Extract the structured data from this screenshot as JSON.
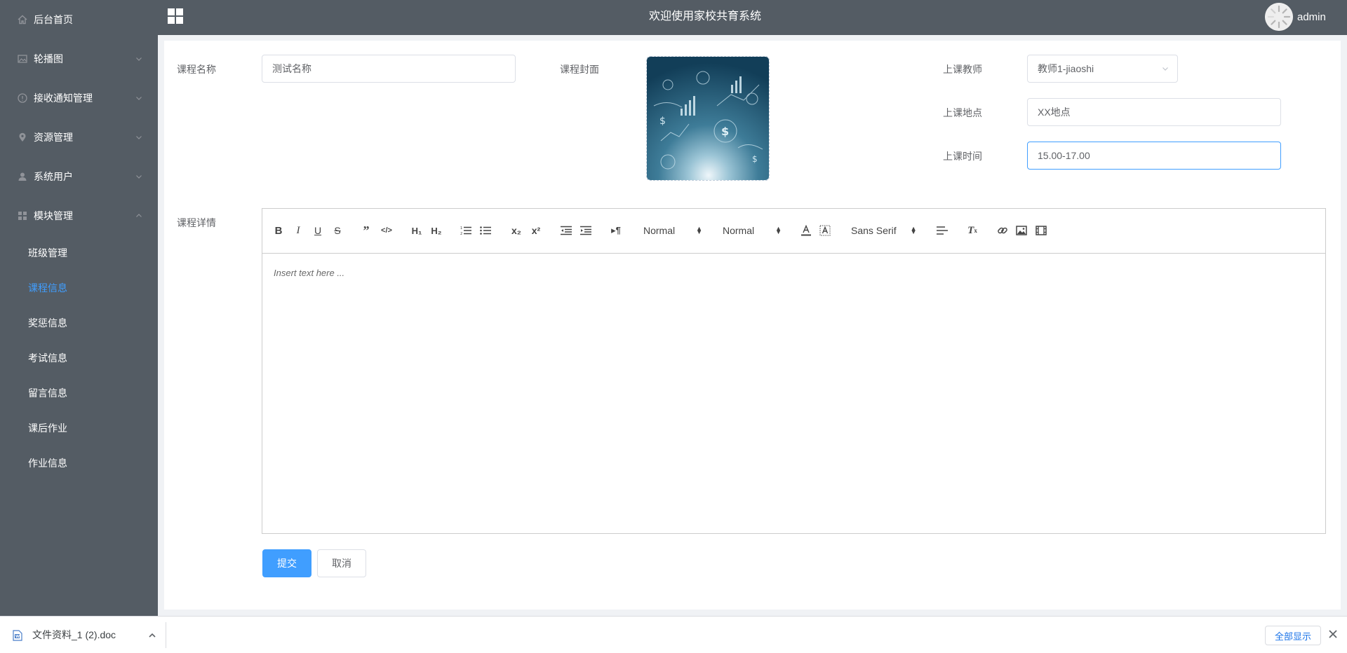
{
  "header": {
    "title": "欢迎使用家校共育系统",
    "user_name": "admin"
  },
  "sidebar": {
    "items": [
      {
        "label": "后台首页",
        "icon": "home-icon"
      },
      {
        "label": "轮播图",
        "icon": "picture-icon"
      },
      {
        "label": "接收通知管理",
        "icon": "info-icon"
      },
      {
        "label": "资源管理",
        "icon": "location-icon"
      },
      {
        "label": "系统用户",
        "icon": "user-icon"
      },
      {
        "label": "模块管理",
        "icon": "menu-icon"
      }
    ],
    "sub_items": [
      {
        "label": "班级管理"
      },
      {
        "label": "课程信息",
        "active": true
      },
      {
        "label": "奖惩信息"
      },
      {
        "label": "考试信息"
      },
      {
        "label": "留言信息"
      },
      {
        "label": "课后作业"
      },
      {
        "label": "作业信息"
      }
    ]
  },
  "form": {
    "course_name_label": "课程名称",
    "course_name_value": "测试名称",
    "cover_label": "课程封面",
    "teacher_label": "上课教师",
    "teacher_value": "教师1-jiaoshi",
    "location_label": "上课地点",
    "location_value": "XX地点",
    "time_label": "上课时间",
    "time_value": "15.00-17.00",
    "details_label": "课程详情",
    "editor_placeholder": "Insert text here ...",
    "submit_label": "提交",
    "cancel_label": "取消"
  },
  "toolbar": {
    "header_select": "Normal",
    "size_select": "Normal",
    "font_select": "Sans Serif"
  },
  "download_bar": {
    "file_name": "文件资料_1 (2).doc",
    "show_all_label": "全部显示"
  },
  "colors": {
    "sidebar_bg": "#545c64",
    "accent": "#409EFF"
  }
}
